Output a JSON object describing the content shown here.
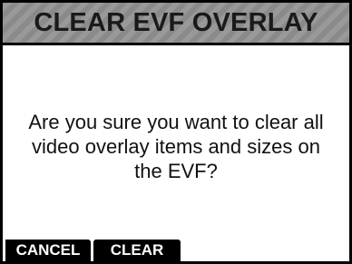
{
  "dialog": {
    "title": "CLEAR EVF OVERLAY",
    "message_lines": [
      "Are you sure you want to clear all",
      "video overlay items and sizes on",
      "the EVF?"
    ]
  },
  "softkeys": {
    "cancel_label": "CANCEL",
    "clear_label": "CLEAR"
  },
  "colors": {
    "title_bar": "#8f8f8f",
    "softkey_bg": "#000000",
    "softkey_text": "#ffffff",
    "background": "#ffffff"
  }
}
